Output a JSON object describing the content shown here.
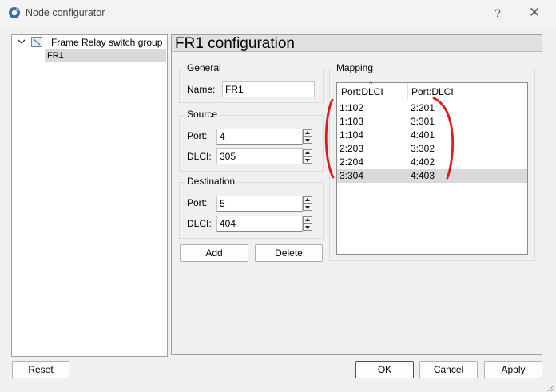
{
  "window": {
    "title": "Node configurator",
    "help_label": "?",
    "close_label": "✕"
  },
  "tree": {
    "group_label": "Frame Relay switch group",
    "child_label": "FR1"
  },
  "panel": {
    "title": "FR1  configuration"
  },
  "general": {
    "title": "General",
    "name_label": "Name:",
    "name_value": "FR1"
  },
  "source": {
    "title": "Source",
    "port_label": "Port:",
    "port_value": "4",
    "dlci_label": "DLCI:",
    "dlci_value": "305"
  },
  "destination": {
    "title": "Destination",
    "port_label": "Port:",
    "port_value": "5",
    "dlci_label": "DLCI:",
    "dlci_value": "404"
  },
  "actions": {
    "add_label": "Add",
    "delete_label": "Delete"
  },
  "mapping": {
    "title": "Mapping",
    "columns": [
      "Port:DLCI",
      "Port:DLCI"
    ],
    "rows": [
      {
        "from": "1:102",
        "to": "2:201"
      },
      {
        "from": "1:103",
        "to": "3:301"
      },
      {
        "from": "1:104",
        "to": "4:401"
      },
      {
        "from": "2:203",
        "to": "3:302"
      },
      {
        "from": "2:204",
        "to": "4:402"
      },
      {
        "from": "3:304",
        "to": "4:403"
      }
    ],
    "selected_row": 5
  },
  "footer": {
    "reset_label": "Reset",
    "ok_label": "OK",
    "cancel_label": "Cancel",
    "apply_label": "Apply"
  },
  "colors": {
    "annotation": "#e0191b",
    "primary_border": "#0067c0",
    "selection": "#d9d9d9"
  }
}
